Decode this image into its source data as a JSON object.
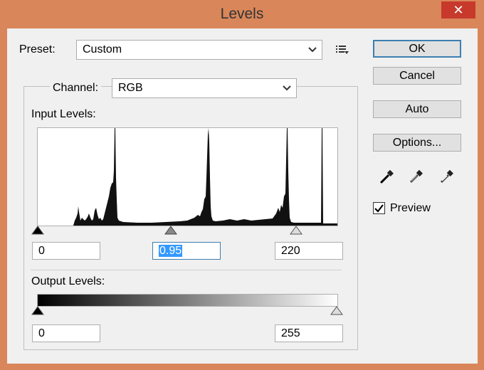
{
  "window": {
    "title": "Levels",
    "close_glyph": "✕"
  },
  "preset": {
    "label": "Preset:",
    "value": "Custom"
  },
  "channel": {
    "label": "Channel:",
    "value": "RGB"
  },
  "input_levels": {
    "label": "Input Levels:",
    "black": "0",
    "gamma": "0.95",
    "white": "220"
  },
  "output_levels": {
    "label": "Output Levels:",
    "black": "0",
    "white": "255"
  },
  "buttons": {
    "ok": "OK",
    "cancel": "Cancel",
    "auto": "Auto",
    "options": "Options..."
  },
  "preview": {
    "label": "Preview",
    "checked": true
  },
  "colors": {
    "titlebar": "#d9865a",
    "close": "#c7392b",
    "default_border": "#3c7fb1",
    "selection": "#3399ff"
  },
  "icons": [
    "close-icon",
    "preset-menu-icon",
    "black-eyedropper-icon",
    "gray-eyedropper-icon",
    "white-eyedropper-icon",
    "check-icon",
    "chevron-down-icon"
  ]
}
